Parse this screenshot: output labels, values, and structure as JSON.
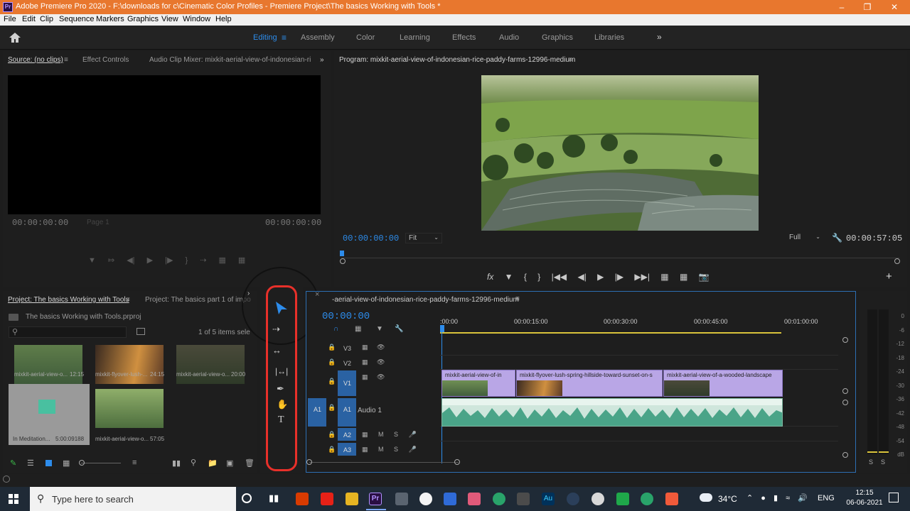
{
  "app": {
    "icon": "Pr",
    "title": "Adobe Premiere Pro 2020 - F:\\downloads for c\\Cinematic Color Profiles - Premiere Project\\The basics Working with Tools *"
  },
  "menu": [
    "File",
    "Edit",
    "Clip",
    "Sequence",
    "Markers",
    "Graphics",
    "View",
    "Window",
    "Help"
  ],
  "workspaces": [
    "Editing",
    "Assembly",
    "Color",
    "Learning",
    "Effects",
    "Audio",
    "Graphics",
    "Libraries"
  ],
  "active_workspace": "Editing",
  "source_panel": {
    "tabs": [
      "Source: (no clips)",
      "Effect Controls",
      "Audio Clip Mixer: mixkit-aerial-view-of-indonesian-ri"
    ],
    "tc_left": "00:00:00:00",
    "page": "Page 1",
    "tc_right": "00:00:00:00"
  },
  "program_panel": {
    "title": "Program: mixkit-aerial-view-of-indonesian-rice-paddy-farms-12996-medium",
    "timecode": "00:00:00:00",
    "fit": "Fit",
    "quality": "Full",
    "duration": "00:00:57:05"
  },
  "project_panel": {
    "tabs": [
      "Project: The basics Working with Tools",
      "Project: The basics part 1 of impo"
    ],
    "file": "The basics Working with Tools.prproj",
    "items_count": "1 of 5 items sele",
    "items": [
      {
        "name": "mixkit-aerial-view-o...",
        "duration": "12:15"
      },
      {
        "name": "mixkit-flyover-lush-...",
        "duration": "24:15"
      },
      {
        "name": "mixkit-aerial-view-o...",
        "duration": "20:00"
      },
      {
        "name": "In Meditation...",
        "duration": "5:00:09188"
      },
      {
        "name": "mixkit-aerial-view-o...",
        "duration": "57:05"
      }
    ]
  },
  "timeline": {
    "tab": "-aerial-view-of-indonesian-rice-paddy-farms-12996-medium",
    "timecode": "00:00:00",
    "ruler": [
      ":00:00",
      "00:00:15:00",
      "00:00:30:00",
      "00:00:45:00",
      "00:01:00:00"
    ],
    "tracks": [
      "V3",
      "V2",
      "V1",
      "A1",
      "A2",
      "A3"
    ],
    "source_patch": "A1",
    "audio_track_name": "Audio 1",
    "clips": [
      "mixkit-aerial-view-of-in",
      "mixkit-flyover-lush-spring-hillside-toward-sunset-on-s",
      "mixkit-aerial-view-of-a-wooded-landscape"
    ]
  },
  "meters": {
    "scale": [
      "0",
      "-6",
      "-12",
      "-18",
      "-24",
      "-30",
      "-36",
      "-42",
      "-48",
      "-54",
      "dB"
    ],
    "solo": [
      "S",
      "S"
    ]
  },
  "tools": [
    "selection-tool",
    "track-select-tool",
    "ripple-edit-tool",
    "slip-tool",
    "pen-tool",
    "hand-tool",
    "type-tool"
  ],
  "taskbar": {
    "search_placeholder": "Type here to search",
    "weather": "34°C",
    "lang": "ENG",
    "time": "12:15",
    "date": "06-06-2021"
  },
  "colors": {
    "title_bar": "#e8772e",
    "accent_blue": "#2d8ceb",
    "clip_violet": "#b9a6e6",
    "audio_green": "#4aa488",
    "annotation_red": "#e8302a"
  }
}
